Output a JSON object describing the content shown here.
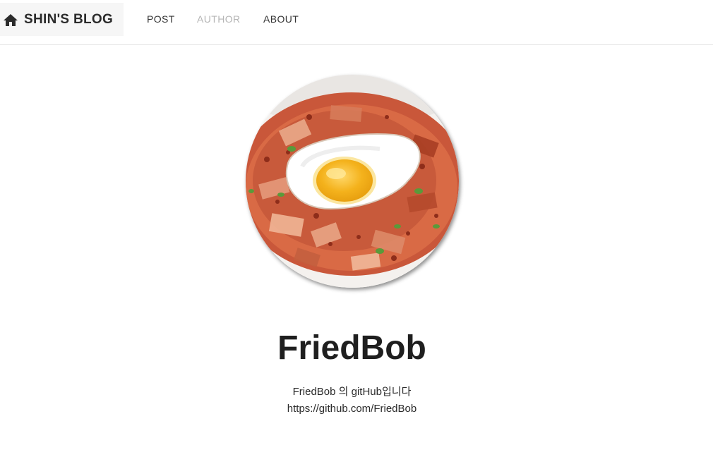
{
  "navbar": {
    "brand_label": "SHIN'S BLOG",
    "brand_icon": "home-icon",
    "links": [
      {
        "label": "POST",
        "active": false
      },
      {
        "label": "AUTHOR",
        "active": true
      },
      {
        "label": "ABOUT",
        "active": false
      }
    ]
  },
  "author": {
    "avatar_alt": "fried rice with egg",
    "name": "FriedBob",
    "description": "FriedBob 의 gitHub입니다",
    "github_url": "https://github.com/FriedBob"
  },
  "colors": {
    "active_link": "#b5b5b5",
    "text": "#222222",
    "brand_bg": "#f6f6f6"
  }
}
